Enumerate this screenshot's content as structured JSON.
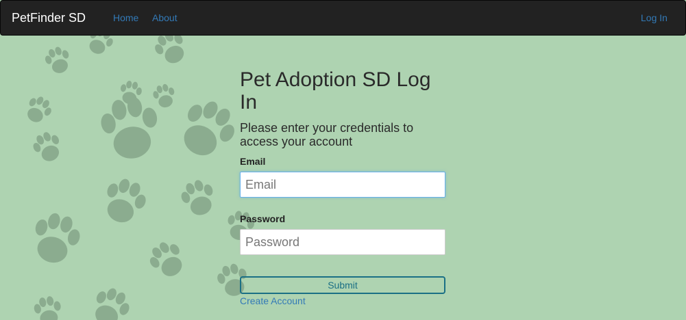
{
  "navbar": {
    "brand": "PetFinder SD",
    "links": [
      {
        "label": "Home"
      },
      {
        "label": "About"
      }
    ],
    "login_label": "Log In"
  },
  "form": {
    "title": "Pet Adoption SD Log In",
    "subtitle": "Please enter your credentials to access your account",
    "email_label": "Email",
    "email_placeholder": "Email",
    "password_label": "Password",
    "password_placeholder": "Password",
    "submit_label": "Submit",
    "create_account_label": "Create Account"
  },
  "background": {
    "color": "#aed3b1",
    "pattern_icon": "paw-print-icon"
  }
}
